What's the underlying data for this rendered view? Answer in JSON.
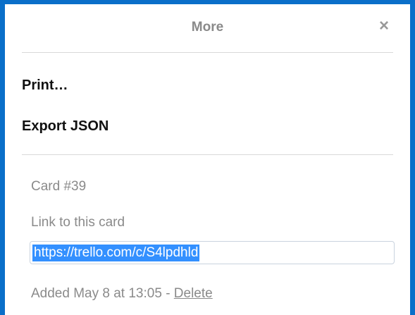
{
  "popover": {
    "title": "More",
    "close_glyph": "×"
  },
  "menu": {
    "print_label": "Print…",
    "export_label": "Export JSON"
  },
  "card": {
    "number_label": "Card #39",
    "link_label": "Link to this card",
    "link_value": "https://trello.com/c/S4lpdhld",
    "added_text": "Added May 8 at 13:05 - ",
    "delete_label": "Delete"
  },
  "colors": {
    "frame_border": "#0a6fc9",
    "selection": "#3390ff",
    "muted_text": "#8a8a8a"
  }
}
